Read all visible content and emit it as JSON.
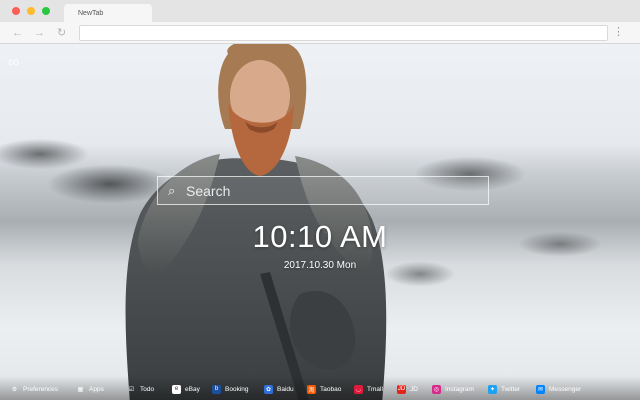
{
  "browser": {
    "tab_title": "NewTab",
    "nav": {
      "back": "←",
      "forward": "→",
      "reload": "↻",
      "menu": "⋮"
    }
  },
  "page": {
    "search_placeholder": "Search",
    "clock": "10:10 AM",
    "date": "2017.10.30 Mon"
  },
  "bottombar": {
    "items": [
      {
        "label": "Preferences",
        "icon": "gear-icon",
        "color": "#ffffff"
      },
      {
        "label": "Apps",
        "icon": "apps-grid-icon",
        "color": "#ffffff"
      },
      {
        "label": "Todo",
        "icon": "checkbox-icon",
        "color": "#ffffff"
      },
      {
        "label": "eBay",
        "icon": "ebay-icon",
        "color": "#ffffff"
      },
      {
        "label": "Booking",
        "icon": "booking-icon",
        "color": "#1d4fa0"
      },
      {
        "label": "Baidu",
        "icon": "baidu-icon",
        "color": "#2e6fdb"
      },
      {
        "label": "Taobao",
        "icon": "taobao-icon",
        "color": "#f25c05"
      },
      {
        "label": "Tmall",
        "icon": "tmall-icon",
        "color": "#e01a3c"
      },
      {
        "label": "JD",
        "icon": "jd-icon",
        "color": "#e1251b"
      },
      {
        "label": "Instagram",
        "icon": "instagram-icon",
        "color": "#d52b8b"
      },
      {
        "label": "Twitter",
        "icon": "twitter-icon",
        "color": "#1da1f2"
      },
      {
        "label": "Messenger",
        "icon": "messenger-icon",
        "color": "#0084ff"
      }
    ]
  }
}
